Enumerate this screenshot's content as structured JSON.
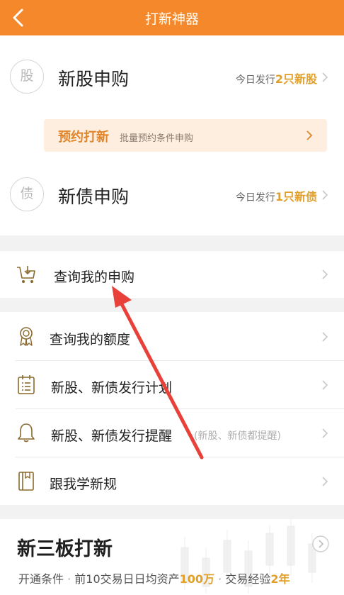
{
  "header": {
    "title": "打新神器"
  },
  "ipo": {
    "stock": {
      "icon_char": "股",
      "label": "新股申购",
      "info_prefix": "今日发行",
      "info_value": "2只新股"
    },
    "promo": {
      "title": "预约打新",
      "subtitle": "批量预约条件申购"
    },
    "bond": {
      "icon_char": "债",
      "label": "新债申购",
      "info_prefix": "今日发行",
      "info_value": "1只新债"
    }
  },
  "menu": {
    "query_subscription": "查询我的申购",
    "query_quota": "查询我的额度",
    "issue_plan": "新股、新债发行计划",
    "issue_reminder": "新股、新债发行提醒",
    "issue_reminder_hint": "(新股、新债都提醒)",
    "learn_rules": "跟我学新规"
  },
  "new_third_board": {
    "title": "新三板打新",
    "condition_label": "开通条件",
    "condition_1": "前10交易日日均资产",
    "condition_1_value": "100万",
    "condition_2": "交易经验",
    "condition_2_value": "2年"
  },
  "colors": {
    "accent": "#f5882a",
    "highlight": "#e0a02a",
    "annotation_arrow": "#e8413a"
  }
}
